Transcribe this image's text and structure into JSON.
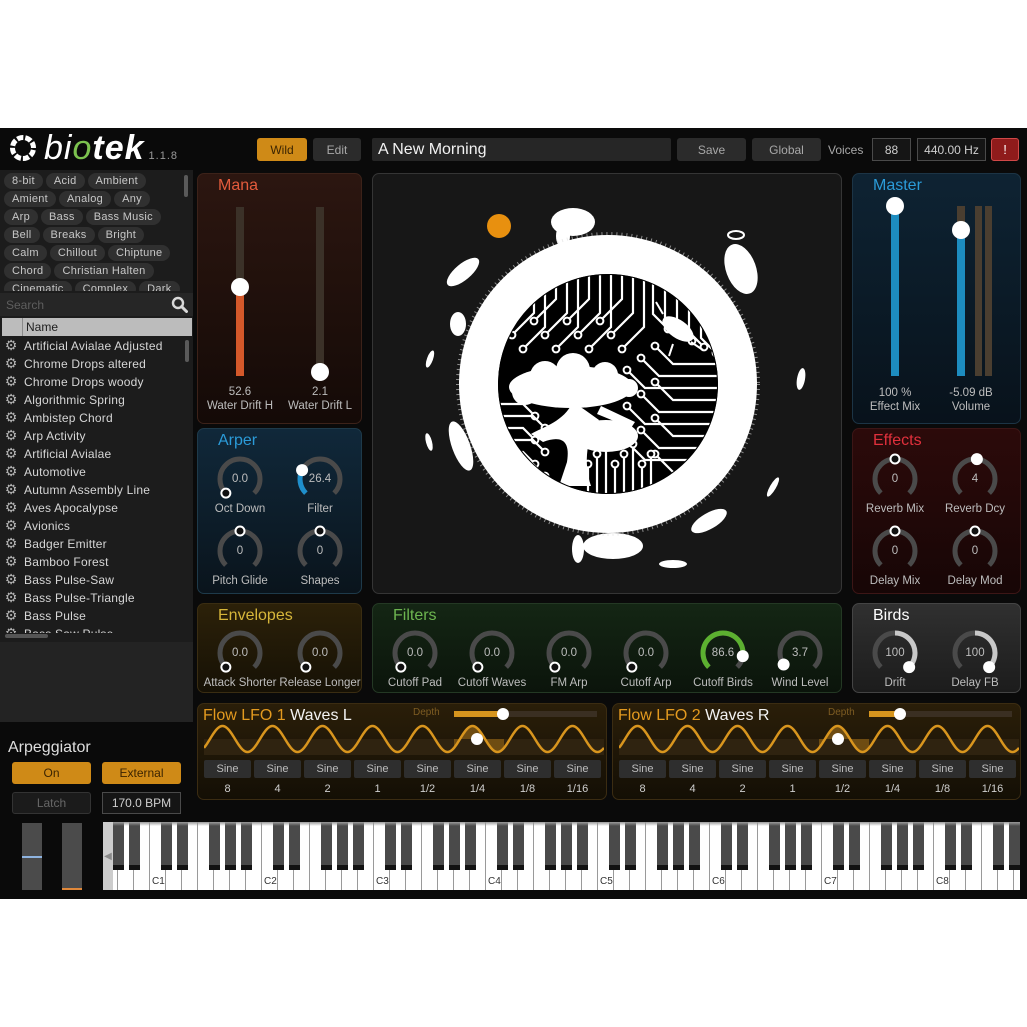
{
  "app": {
    "logo": {
      "part1": "bi",
      "part2": "o",
      "part3": "tek"
    },
    "version": "1.1.8"
  },
  "header": {
    "wild_button": "Wild",
    "edit_button": "Edit",
    "preset_name": "A New Morning",
    "save_button": "Save",
    "global_button": "Global",
    "voices_label": "Voices",
    "voices_value": "88",
    "tuning_value": "440.00 Hz",
    "alert_button": "!"
  },
  "sidebar": {
    "tags": [
      "8-bit",
      "Acid",
      "Ambient",
      "Amient",
      "Analog",
      "Any",
      "Arp",
      "Bass",
      "Bass Music",
      "Bell",
      "Breaks",
      "Bright",
      "Calm",
      "Chillout",
      "Chiptune",
      "Chord",
      "Christian Halten",
      "Cinematic",
      "Complex",
      "Dark"
    ],
    "search_placeholder": "Search",
    "list_header": "Name",
    "row_icon": "gear-icon",
    "presets": [
      "Artificial Avialae Adjusted",
      "Chrome Drops altered",
      "Chrome Drops woody",
      "Algorithmic Spring",
      "Ambistep Chord",
      "Arp Activity",
      "Artificial Avialae",
      "Automotive",
      "Autumn Assembly Line",
      "Aves Apocalypse",
      "Avionics",
      "Badger Emitter",
      "Bamboo Forest",
      "Bass Pulse-Saw",
      "Bass Pulse-Triangle",
      "Bass Pulse",
      "Bass Saw Pulse"
    ]
  },
  "arpeggiator": {
    "title": "Arpeggiator",
    "on_button": "On",
    "external_button": "External",
    "latch_button": "Latch",
    "tempo": "170.0 BPM",
    "wheels": [
      {
        "name": "pitch-bend-wheel",
        "fraction": 0.5
      },
      {
        "name": "mod-wheel",
        "fraction": 0.0
      }
    ]
  },
  "panels": {
    "mana": {
      "title": "Mana",
      "sliders": [
        {
          "label": "Water Drift H",
          "value": "52.6",
          "fraction": 0.526
        },
        {
          "label": "Water Drift L",
          "value": "2.1",
          "fraction": 0.021
        }
      ]
    },
    "arper": {
      "title": "Arper",
      "knobs": [
        {
          "label": "Oct Down",
          "value": "0.0",
          "fraction": 0.0,
          "mode": "unipolar"
        },
        {
          "label": "Filter",
          "value": "26.4",
          "fraction": 0.264,
          "mode": "unipolar"
        },
        {
          "label": "Pitch Glide",
          "value": "0",
          "fraction": 0.5,
          "mode": "bipolar"
        },
        {
          "label": "Shapes",
          "value": "0",
          "fraction": 0.5,
          "mode": "bipolar"
        }
      ]
    },
    "master": {
      "title": "Master",
      "sliders": [
        {
          "label": "Effect Mix",
          "value": "100 %",
          "fraction": 1.0
        },
        {
          "label": "Volume",
          "value": "-5.09 dB",
          "fraction": 0.86
        }
      ]
    },
    "effects": {
      "title": "Effects",
      "knobs": [
        {
          "label": "Reverb Mix",
          "value": "0",
          "fraction": 0.5,
          "mode": "bipolar"
        },
        {
          "label": "Reverb Dcy",
          "value": "4",
          "fraction": 0.52,
          "mode": "bipolar"
        },
        {
          "label": "Delay Mix",
          "value": "0",
          "fraction": 0.5,
          "mode": "bipolar"
        },
        {
          "label": "Delay Mod",
          "value": "0",
          "fraction": 0.5,
          "mode": "bipolar"
        }
      ]
    },
    "envelopes": {
      "title": "Envelopes",
      "knobs": [
        {
          "label": "Attack Shorter",
          "value": "0.0",
          "fraction": 0.0,
          "mode": "unipolar"
        },
        {
          "label": "Release Longer",
          "value": "0.0",
          "fraction": 0.0,
          "mode": "unipolar"
        }
      ]
    },
    "filters": {
      "title": "Filters",
      "knobs": [
        {
          "label": "Cutoff Pad",
          "value": "0.0",
          "fraction": 0.0,
          "mode": "unipolar"
        },
        {
          "label": "Cutoff Waves",
          "value": "0.0",
          "fraction": 0.0,
          "mode": "unipolar"
        },
        {
          "label": "FM Arp",
          "value": "0.0",
          "fraction": 0.0,
          "mode": "unipolar"
        },
        {
          "label": "Cutoff Arp",
          "value": "0.0",
          "fraction": 0.0,
          "mode": "unipolar"
        },
        {
          "label": "Cutoff Birds",
          "value": "86.6",
          "fraction": 0.866,
          "mode": "unipolar"
        },
        {
          "label": "Wind Level",
          "value": "3.7",
          "fraction": 0.037,
          "mode": "unipolar"
        }
      ]
    },
    "birds": {
      "title": "Birds",
      "knobs": [
        {
          "label": "Drift",
          "value": "100",
          "fraction": 1.0,
          "mode": "bipolar"
        },
        {
          "label": "Delay FB",
          "value": "100",
          "fraction": 1.0,
          "mode": "bipolar"
        }
      ]
    }
  },
  "lfos": [
    {
      "title": "Flow LFO 1",
      "target": "Waves L",
      "depth_label": "Depth",
      "depth": 0.34,
      "active_step": 5,
      "playhead": 0.46,
      "steps": [
        {
          "shape": "Sine",
          "division": "8"
        },
        {
          "shape": "Sine",
          "division": "4"
        },
        {
          "shape": "Sine",
          "division": "2"
        },
        {
          "shape": "Sine",
          "division": "1"
        },
        {
          "shape": "Sine",
          "division": "1/2"
        },
        {
          "shape": "Sine",
          "division": "1/4"
        },
        {
          "shape": "Sine",
          "division": "1/8"
        },
        {
          "shape": "Sine",
          "division": "1/16"
        }
      ]
    },
    {
      "title": "Flow LFO 2",
      "target": "Waves R",
      "depth_label": "Depth",
      "depth": 0.22,
      "active_step": 4,
      "playhead": 0.38,
      "steps": [
        {
          "shape": "Sine",
          "division": "8"
        },
        {
          "shape": "Sine",
          "division": "4"
        },
        {
          "shape": "Sine",
          "division": "2"
        },
        {
          "shape": "Sine",
          "division": "1"
        },
        {
          "shape": "Sine",
          "division": "1/2"
        },
        {
          "shape": "Sine",
          "division": "1/4"
        },
        {
          "shape": "Sine",
          "division": "1/8"
        },
        {
          "shape": "Sine",
          "division": "1/16"
        }
      ]
    }
  ],
  "keyboard": {
    "first_note": "G",
    "octave_labels": [
      "C1",
      "C2",
      "C3",
      "C4",
      "C5",
      "C6",
      "C7",
      "C8"
    ],
    "scroll_icon": "chevron-left-icon"
  },
  "colors": {
    "accent_orange": "#cf8a17",
    "mana": "#e35b3c",
    "mana_fill": "#d4582a",
    "arper": "#2b9bd8",
    "arper_arc": "#1e8fcc",
    "master": "#2b9bd8",
    "master_fill": "#1d8cbf",
    "effects": "#e0303c",
    "effects_arc": "#c83030",
    "envelopes": "#d6b63a",
    "envelopes_arc": "#d6b63a",
    "filters": "#6db550",
    "filters_arc": "#5cb030",
    "birds": "#ffffff",
    "birds_arc": "#c8c8c8",
    "lfo": "#e39a1f",
    "sun": "#e8900f",
    "alert": "#8f1b1b"
  }
}
